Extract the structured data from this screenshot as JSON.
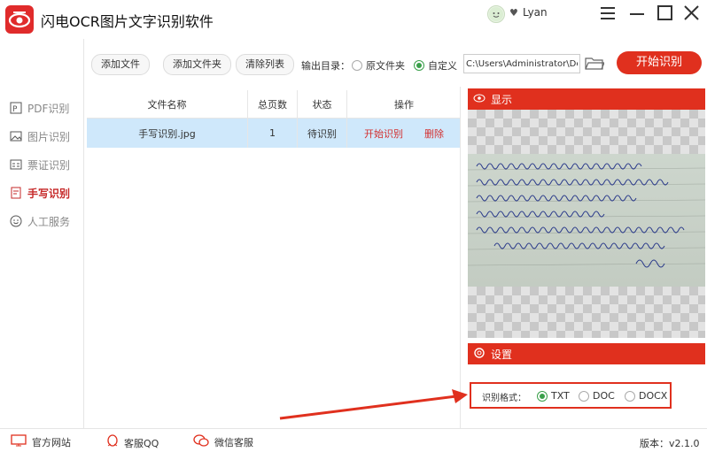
{
  "app": {
    "title": "闪电OCR图片文字识别软件",
    "user": "Lyan"
  },
  "sidebar": {
    "items": [
      {
        "label": "PDF识别",
        "icon": "pdf-icon"
      },
      {
        "label": "图片识别",
        "icon": "image-icon"
      },
      {
        "label": "票证识别",
        "icon": "card-icon"
      },
      {
        "label": "手写识别",
        "icon": "handwrite-icon",
        "active": true
      },
      {
        "label": "人工服务",
        "icon": "smile-icon"
      }
    ]
  },
  "toolbar": {
    "add_file": "添加文件",
    "add_folder": "添加文件夹",
    "clear_list": "清除列表",
    "output_dir_label": "输出目录：",
    "radio_original": "原文件夹",
    "radio_custom": "自定义",
    "path": "C:\\Users\\Administrator\\De",
    "start": "开始识别"
  },
  "table": {
    "headers": [
      "文件名称",
      "总页数",
      "状态",
      "操作"
    ],
    "rows": [
      {
        "name": "手写识别.jpg",
        "pages": "1",
        "status": "待识别",
        "action_start": "开始识别",
        "action_delete": "删除"
      }
    ]
  },
  "preview": {
    "title": "显示"
  },
  "settings": {
    "title": "设置",
    "format_label": "识别格式：",
    "options": [
      "TXT",
      "DOC",
      "DOCX"
    ],
    "selected": "TXT"
  },
  "footer": {
    "website": "官方网站",
    "qq": "客服QQ",
    "wechat": "微信客服",
    "version": "版本：v2.1.0"
  },
  "colors": {
    "accent": "#e0301e",
    "selected_row": "#cfe8fb",
    "radio_on": "#3aa04a"
  }
}
